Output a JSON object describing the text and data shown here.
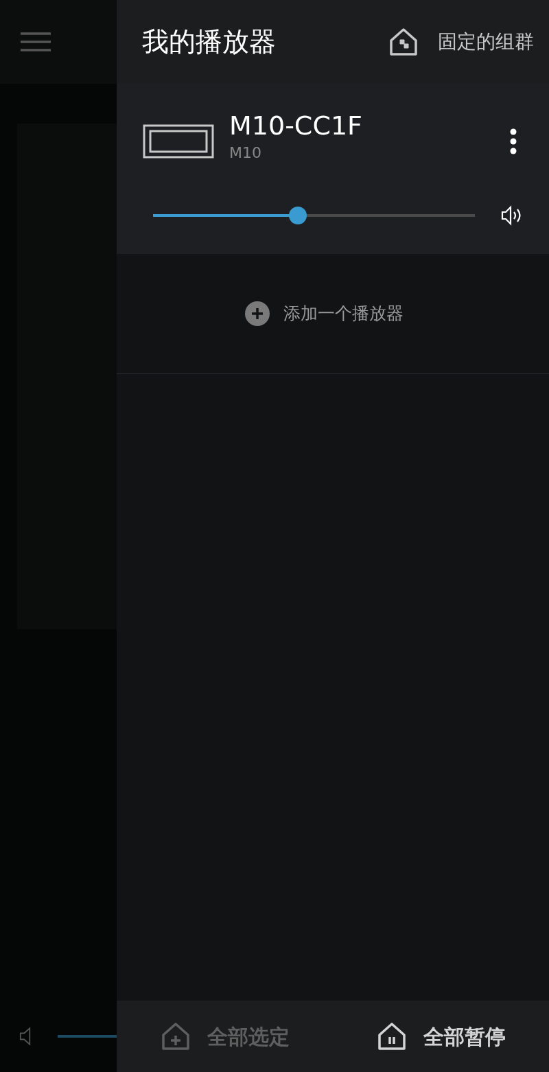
{
  "drawer": {
    "title": "我的播放器",
    "pinned_groups_label": "固定的组群",
    "players": [
      {
        "name": "M10-CC1F",
        "model": "M10",
        "volume": {
          "level": 0.45
        }
      }
    ],
    "add_player_label": "添加一个播放器",
    "footer_buttons": [
      {
        "kind": "select",
        "label": "全部选定",
        "disabled": true
      },
      {
        "kind": "pause",
        "label": "全部暂停",
        "disabled": false
      }
    ]
  }
}
